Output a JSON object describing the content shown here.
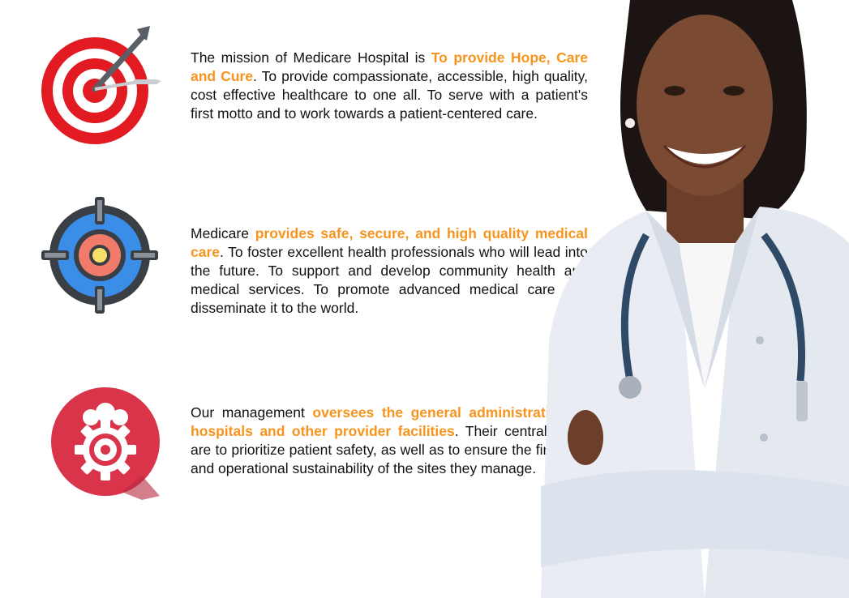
{
  "colors": {
    "accent": "#f7941d",
    "text": "#111111",
    "icon_red": "#e21b23",
    "icon_dark": "#3a3f45",
    "icon_blue": "#3b8ee8",
    "icon_coral": "#f07b6b",
    "icon_yellow": "#f7e06a",
    "icon_crimson": "#d9344a"
  },
  "sections": [
    {
      "icon": "target-arrow-icon",
      "text_before": "The mission of Medicare Hospital is ",
      "highlight": "To provide Hope, Care and Cure",
      "text_after": ". To provide compassionate, accessible, high quality, cost effective healthcare to one all. To serve with a patient's first motto and to work towards a patient-centered care."
    },
    {
      "icon": "crosshair-target-icon",
      "text_before": "Medicare ",
      "highlight": "provides safe, secure, and high quality medical care",
      "text_after": ". To foster excellent health professionals who will lead into the future. To support and develop community health and medical services. To promote advanced medical care and disseminate it to the world."
    },
    {
      "icon": "team-gear-icon",
      "text_before": "Our management ",
      "highlight": "oversees the general administration of hospitals and other provider facilities",
      "text_after": ". Their central goals are to prioritize patient safety, as well as to ensure the financial and operational sustainability of the sites they manage."
    }
  ],
  "image": {
    "subject": "doctor-photo"
  }
}
